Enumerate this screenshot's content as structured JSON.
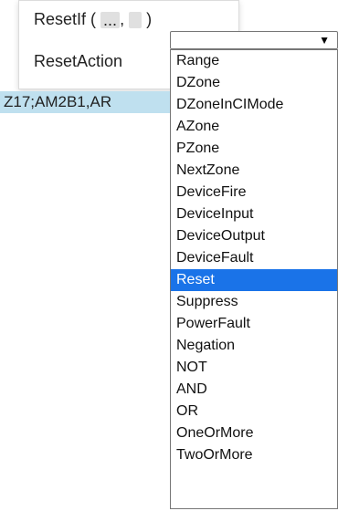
{
  "menu": {
    "item1_prefix": "ResetIf (",
    "slot1": "...",
    "comma": ",",
    "slot2": "",
    "close_paren": ")",
    "item2": "ResetAction"
  },
  "selected_text": "Z17;AM2B1,AR",
  "dropdown": {
    "selected_value": "",
    "options": [
      "Range",
      "DZone",
      "DZoneInCIMode",
      "AZone",
      "PZone",
      "NextZone",
      "DeviceFire",
      "DeviceInput",
      "DeviceOutput",
      "DeviceFault",
      "Reset",
      "Suppress",
      "PowerFault",
      "Negation",
      "NOT",
      "AND",
      "OR",
      "OneOrMore",
      "TwoOrMore"
    ],
    "highlighted": "Reset",
    "highlight_color": "#1a73e8"
  }
}
